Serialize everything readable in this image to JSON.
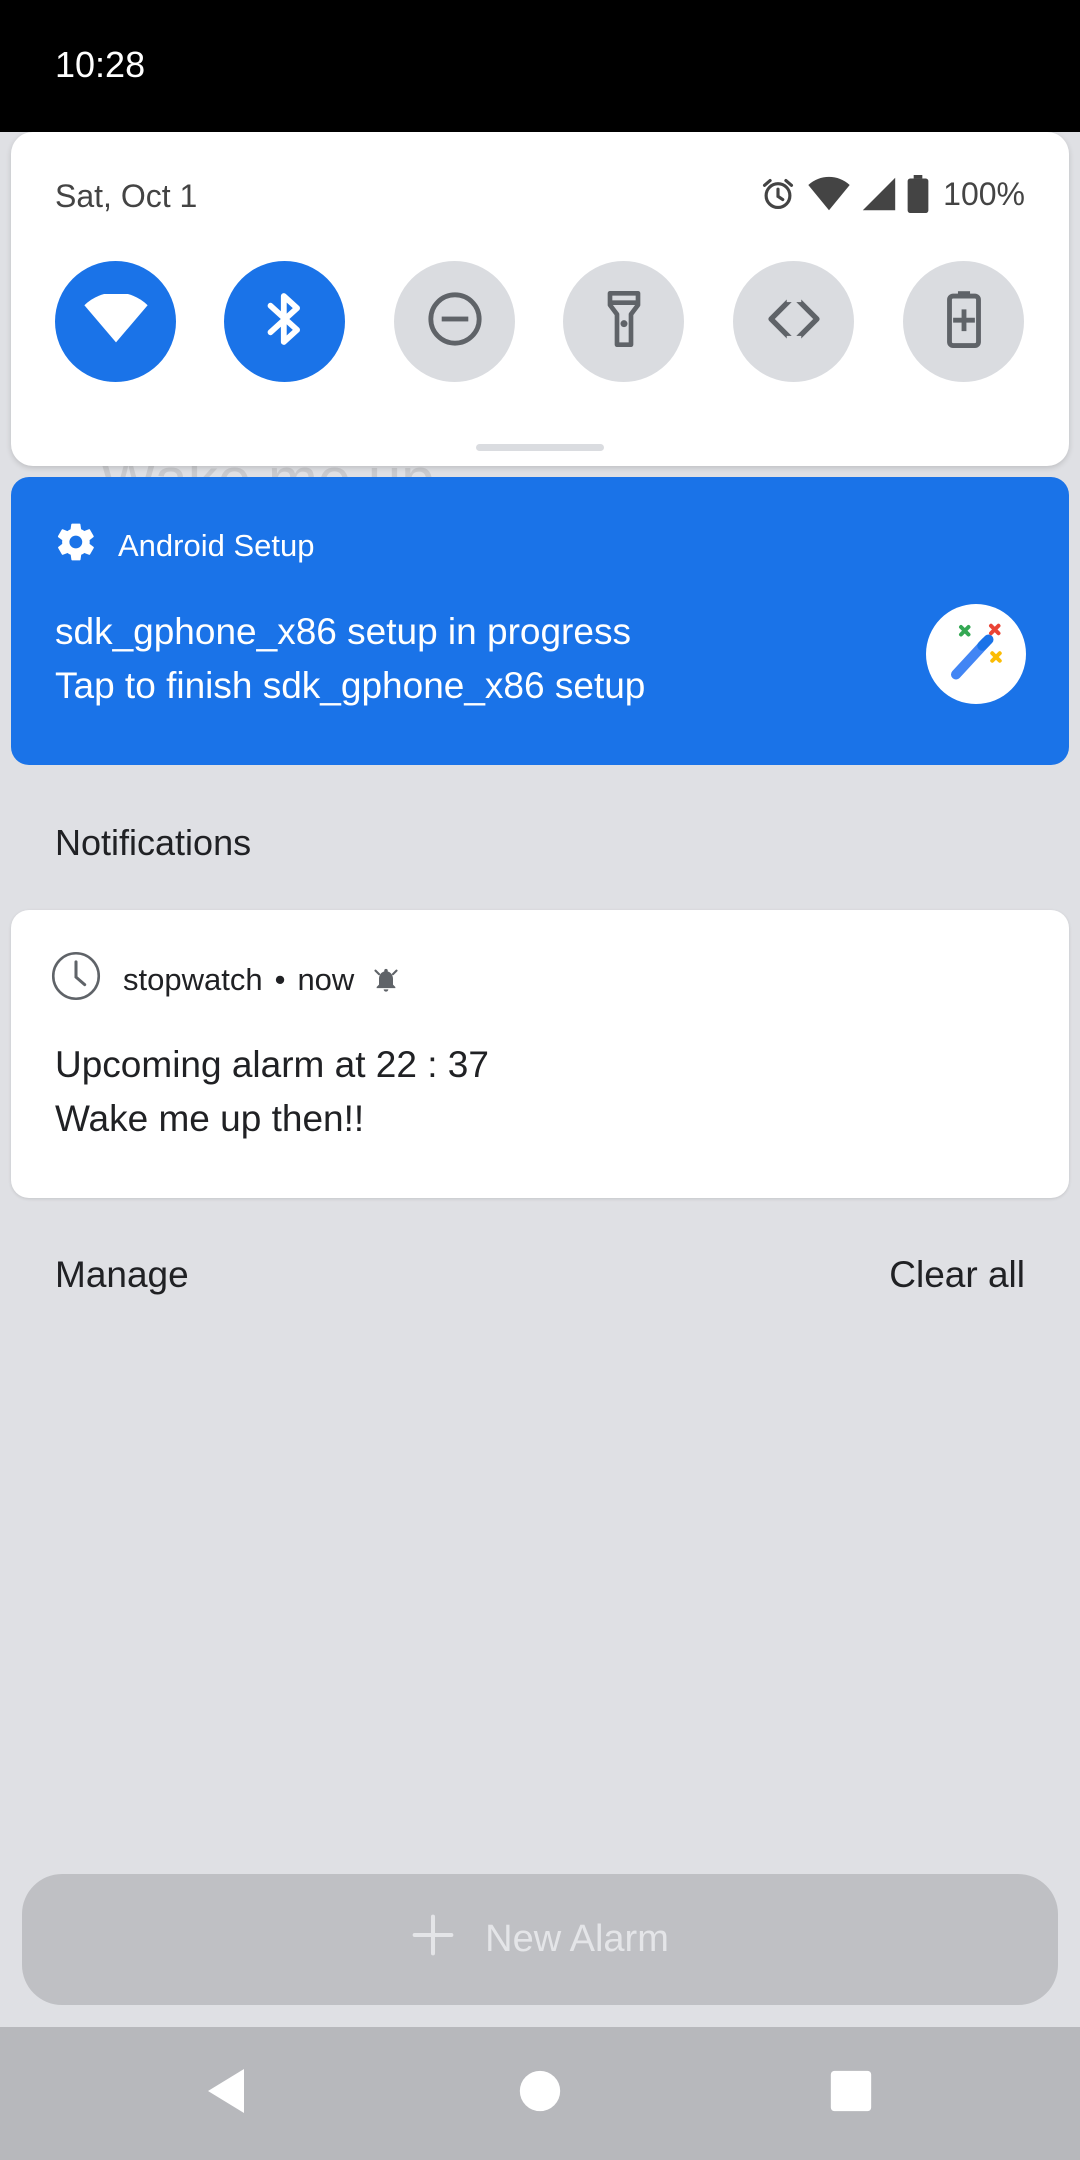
{
  "status_bar": {
    "time": "10:28"
  },
  "quick_settings": {
    "date": "Sat, Oct 1",
    "battery_percent": "100%",
    "tiles": [
      {
        "name": "wifi",
        "active": true
      },
      {
        "name": "bluetooth",
        "active": true
      },
      {
        "name": "do-not-disturb",
        "active": false
      },
      {
        "name": "flashlight",
        "active": false
      },
      {
        "name": "auto-rotate",
        "active": false
      },
      {
        "name": "battery-saver",
        "active": false
      }
    ]
  },
  "background": {
    "ghost_text": "Wake me up"
  },
  "setup_notification": {
    "app_name": "Android Setup",
    "title": "sdk_gphone_x86 setup in progress",
    "text": "Tap to finish sdk_gphone_x86 setup"
  },
  "notifications": {
    "section_title": "Notifications",
    "items": [
      {
        "app_name": "stopwatch",
        "separator": "•",
        "time": "now",
        "title": "Upcoming alarm at 22 : 37",
        "text": "Wake me up then!!"
      }
    ],
    "manage_label": "Manage",
    "clear_all_label": "Clear all"
  },
  "app": {
    "new_alarm_label": "New Alarm"
  },
  "colors": {
    "accent": "#1a73e8",
    "status_bar": "#000000",
    "shade_background": "#dfe0e4"
  }
}
